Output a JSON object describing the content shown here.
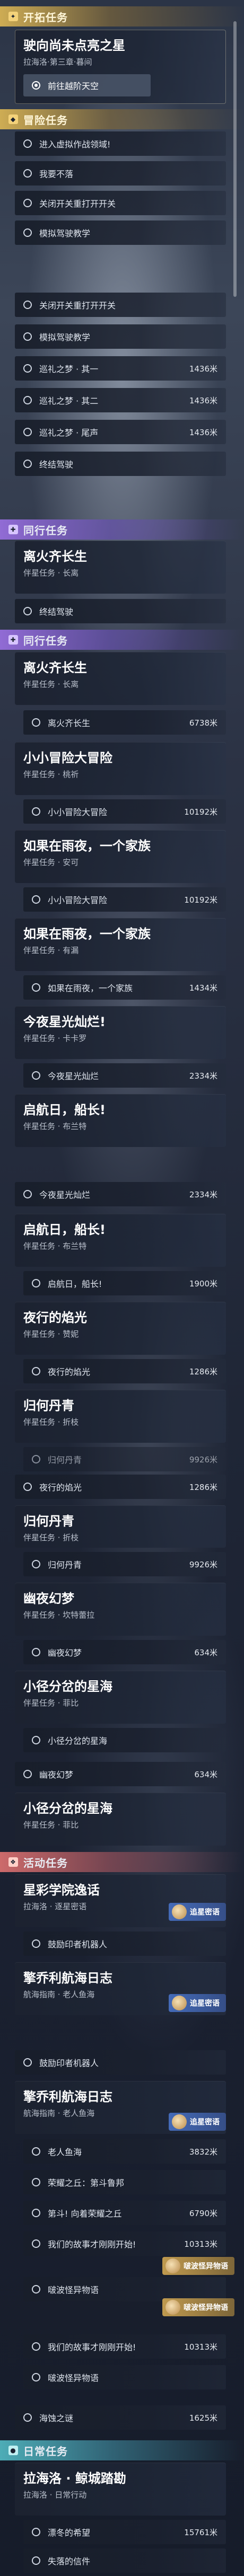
{
  "sections": {
    "trailblaze": "开拓任务",
    "adventure": "冒险任务",
    "companion": "同行任务",
    "event": "活动任务",
    "daily": "日常任务"
  },
  "badges": {
    "chasing_stars": "追星密语",
    "treasure_story": "啵波怪异物语"
  },
  "entries": {
    "e1_title": "驶向尚未点亮之星",
    "e1_sub": "拉海洛·第三章·暮间",
    "e1_obj": "前往越阶天空",
    "e2_obj1": "进入虚拟作战领域!",
    "e2_obj2": "我要不落",
    "e2_obj3": "关闭开关重打开开关",
    "e2_obj4": "模拟驾驶教学",
    "e3_obj1": "关闭开关重打开开关",
    "e3_obj2": "模拟驾驶教学",
    "e3_obj3": "巡礼之梦 · 其一",
    "e3_obj3_dist": "1436米",
    "e3_obj4": "巡礼之梦 · 其二",
    "e3_obj4_dist": "1436米",
    "e3_obj5": "巡礼之梦 · 尾声",
    "e3_obj5_dist": "1436米",
    "e3_obj6": "终结驾驶",
    "e4_title": "离火齐长生",
    "e4_sub": "伴星任务 · 长离",
    "e4_obj": "终结驾驶",
    "e5_title": "离火齐长生",
    "e5_sub": "伴星任务 · 长离",
    "e5_obj": "离火齐长生",
    "e5_obj_dist": "6738米",
    "e6_title": "小小冒险大冒险",
    "e6_sub": "伴星任务 · 桃祈",
    "e6_obj": "小小冒险大冒险",
    "e6_obj_dist": "10192米",
    "e7_title": "如果在雨夜，一个家族",
    "e7_sub": "伴星任务 · 安可",
    "e7_obj": "小小冒险大冒险",
    "e7_obj_dist": "10192米",
    "e8_title": "如果在雨夜，一个家族",
    "e8_sub": "伴星任务 · 有漏",
    "e8_obj": "如果在雨夜，一个家族",
    "e8_obj_dist": "1434米",
    "e9_title": "今夜星光灿烂!",
    "e9_sub": "伴星任务 · 卡卡罗",
    "e9_obj": "今夜星光灿烂",
    "e9_obj_dist": "2334米",
    "e10_title": "启航日，船长!",
    "e10_sub": "伴星任务 · 布兰特",
    "e10_obj": "今夜星光灿烂",
    "e10_obj_dist": "2334米",
    "e11_title": "启航日，船长!",
    "e11_sub": "伴星任务 · 布兰特",
    "e11_obj": "启航日，船长!",
    "e11_obj_dist": "1900米",
    "e12_title": "夜行的焰光",
    "e12_sub": "伴星任务 · 赞妮",
    "e12_obj": "夜行的焰光",
    "e12_obj_dist": "1286米",
    "e13_title": "归何丹青",
    "e13_sub": "伴星任务 · 折枝",
    "e13_obj": "归何丹青",
    "e13_obj_dist": "9926米",
    "e14_title": "归何丹青",
    "e14_sub": "伴星任务 · 折枝",
    "e14_obj": "夜行的焰光",
    "e14_obj_dist": "1286米",
    "e15_obj": "归何丹青",
    "e15_obj_dist": "9926米",
    "e16_title": "幽夜幻梦",
    "e16_sub": "伴星任务 · 坎特蕾拉",
    "e16_obj": "幽夜幻梦",
    "e16_obj_dist": "634米",
    "e17_title": "小径分岔的星海",
    "e17_sub": "伴星任务 · 菲比",
    "e17_obj": "小径分岔的星海",
    "e17_obj_dist": "",
    "e18_obj": "幽夜幻梦",
    "e18_obj_dist": "634米",
    "e19_title": "小径分岔的星海",
    "e19_sub": "伴星任务 · 菲比",
    "e20_title": "星彩学院逸话",
    "e20_sub": "拉海洛 · 逐星密语",
    "e20_obj": "鼓励印者机器人",
    "e21_title": "擎乔利航海日志",
    "e21_sub": "航海指南 · 老人鱼海",
    "e21_obj": "鼓励印者机器人",
    "e22_title": "擎乔利航海日志",
    "e22_sub": "航海指南 · 老人鱼海",
    "e22_obj1": "老人鱼海",
    "e22_obj1_dist": "3832米",
    "e22_obj2": "荣耀之丘：第斗鲁邦",
    "e22_obj3": "第斗! 向着荣耀之丘",
    "e22_obj3_dist": "6790米",
    "e22_obj4": "我们的故事才刚刚开始!",
    "e22_obj4_dist": "10313米",
    "e22_obj5": "啵波怪异物语",
    "e22_obj6": "我们的故事才刚刚开始!",
    "e22_obj6_dist": "10313米",
    "e22_obj7": "啵波怪异物语",
    "e22_obj8": "海蚀之谜",
    "e22_obj8_dist": "1625米",
    "e23_title": "拉海洛 · 鲸城踏勘",
    "e23_sub": "拉海洛 · 日常行动",
    "e23_obj1": "漂冬的希望",
    "e23_obj1_dist": "15761米",
    "e23_obj2": "失落的信件"
  }
}
